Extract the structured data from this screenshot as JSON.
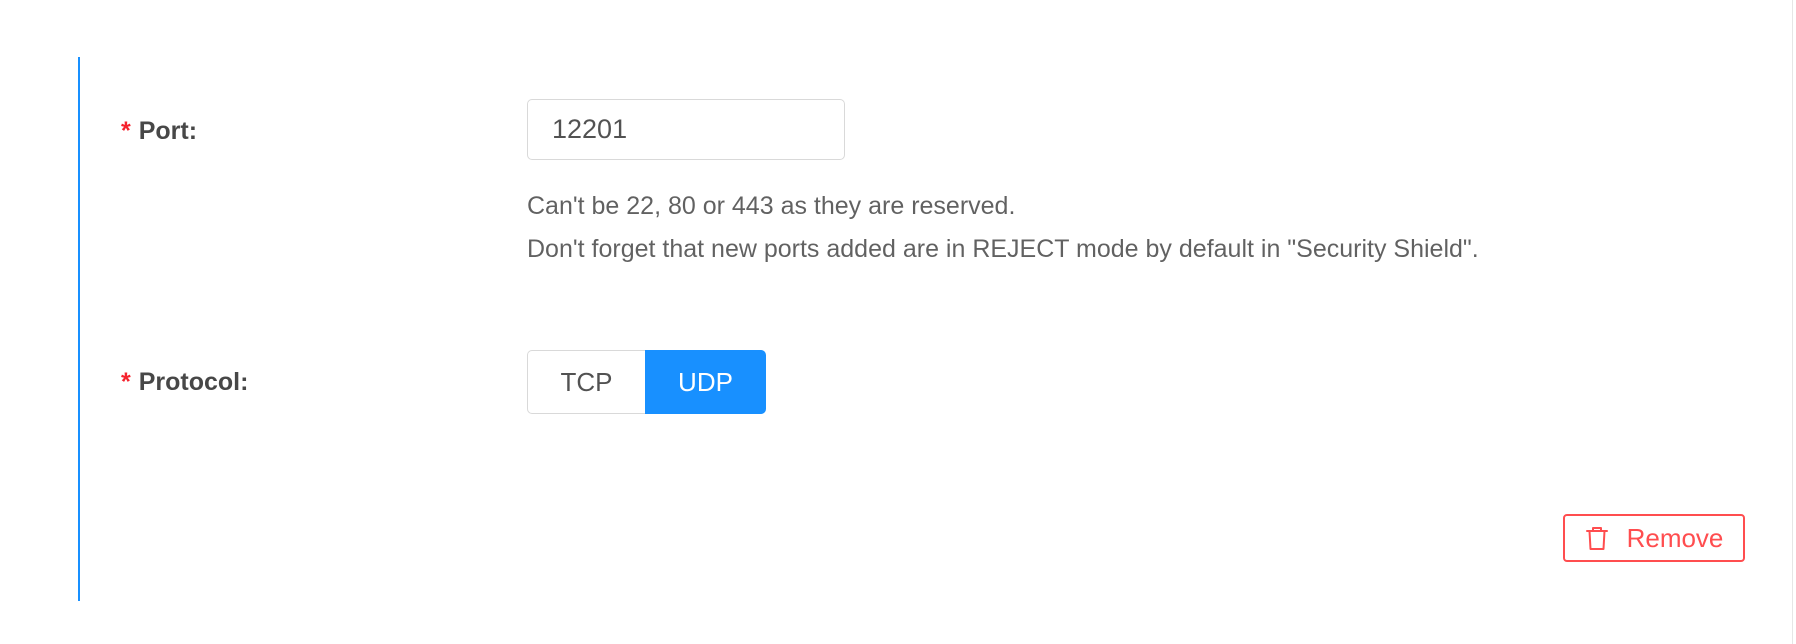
{
  "form": {
    "port": {
      "required_mark": "*",
      "label": "Port:",
      "value": "12201",
      "help_lines": [
        "Can't be 22, 80 or 443 as they are reserved.",
        "Don't forget that new ports added are in REJECT mode by default in \"Security Shield\"."
      ]
    },
    "protocol": {
      "required_mark": "*",
      "label": "Protocol:",
      "options": [
        "TCP",
        "UDP"
      ],
      "selected": "UDP"
    },
    "actions": {
      "remove_label": "Remove",
      "remove_icon": "trash-icon"
    }
  },
  "colors": {
    "accent": "#1890ff",
    "danger": "#ff4d4f",
    "required": "#f5222d"
  }
}
